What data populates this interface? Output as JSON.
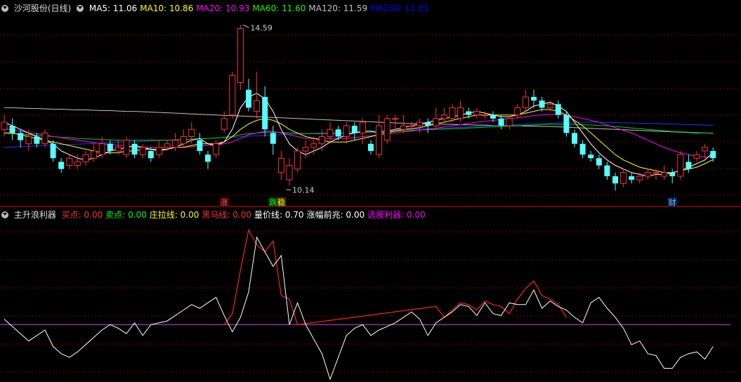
{
  "main_legend": {
    "title": "沙河股份(日线)",
    "items": [
      {
        "label": "MA5: 11.06",
        "color": "#ffffff"
      },
      {
        "label": "MA10: 10.86",
        "color": "#ffff00"
      },
      {
        "label": "MA20: 10.93",
        "color": "#ff00ff"
      },
      {
        "label": "MA60: 11.60",
        "color": "#00ff00"
      },
      {
        "label": "MA120: 11.59",
        "color": "#c0c0c0"
      },
      {
        "label": "MA250: 11.81",
        "color": "#0000ff"
      }
    ]
  },
  "sub_legend": {
    "title": "主升浪利器",
    "items": [
      {
        "label": "买点: 0.00",
        "color": "#ff3030"
      },
      {
        "label": "卖点: 0.00",
        "color": "#00ff00"
      },
      {
        "label": "庄拉线: 0.00",
        "color": "#ffff00"
      },
      {
        "label": "黑马线: 0.00",
        "color": "#ff3030"
      },
      {
        "label": "量价线: 0.70",
        "color": "#ffffff"
      },
      {
        "label": "涨幅前兆: 0.00",
        "color": "#ffffff"
      },
      {
        "label": "选股利器: 0.00",
        "color": "#ff00ff"
      }
    ]
  },
  "annotations": {
    "high_label": "14.59",
    "low_label": "10.14",
    "markers": [
      {
        "text": "涨",
        "color": "#ff5050",
        "bg": "#400000",
        "day": 27
      },
      {
        "text": "跌",
        "color": "#00ff00",
        "bg": "#003000",
        "day": 33
      },
      {
        "text": "稳",
        "color": "#ffff00",
        "bg": "#403000",
        "day": 34
      },
      {
        "text": "财",
        "color": "#80c0ff",
        "bg": "#002050",
        "day": 82
      }
    ]
  },
  "chart_data": {
    "type": "candlestick",
    "price_ylim": [
      9.6,
      14.9
    ],
    "candles": [
      [
        11.7,
        11.9,
        12.1,
        11.5
      ],
      [
        11.8,
        11.6,
        12.0,
        11.4
      ],
      [
        11.6,
        11.4,
        11.7,
        11.2
      ],
      [
        11.3,
        11.5,
        11.7,
        11.1
      ],
      [
        11.5,
        11.3,
        11.6,
        11.2
      ],
      [
        11.3,
        11.6,
        11.7,
        11.2
      ],
      [
        11.3,
        10.9,
        11.4,
        10.8
      ],
      [
        10.8,
        10.6,
        10.9,
        10.5
      ],
      [
        10.7,
        10.9,
        11.0,
        10.6
      ],
      [
        10.7,
        10.8,
        11.0,
        10.6
      ],
      [
        10.8,
        11.0,
        11.1,
        10.7
      ],
      [
        10.9,
        11.1,
        11.3,
        10.8
      ],
      [
        11.0,
        11.3,
        11.5,
        10.9
      ],
      [
        11.3,
        11.1,
        11.4,
        11.0
      ],
      [
        11.1,
        11.2,
        11.4,
        11.0
      ],
      [
        11.0,
        11.4,
        11.5,
        10.9
      ],
      [
        11.3,
        11.0,
        11.4,
        10.9
      ],
      [
        11.0,
        11.2,
        11.3,
        10.9
      ],
      [
        11.1,
        10.9,
        11.2,
        10.8
      ],
      [
        11.0,
        11.2,
        11.4,
        10.9
      ],
      [
        11.2,
        11.3,
        11.4,
        11.1
      ],
      [
        11.2,
        11.4,
        11.6,
        11.1
      ],
      [
        11.3,
        11.5,
        11.7,
        11.2
      ],
      [
        11.5,
        11.7,
        11.9,
        11.3
      ],
      [
        11.4,
        11.1,
        11.6,
        11.0
      ],
      [
        11.0,
        10.8,
        11.1,
        10.6
      ],
      [
        11.0,
        11.3,
        11.4,
        10.9
      ],
      [
        11.7,
        12.0,
        12.2,
        11.6
      ],
      [
        12.1,
        13.2,
        13.3,
        12.0
      ],
      [
        13.0,
        14.5,
        14.6,
        12.8
      ],
      [
        12.8,
        12.3,
        13.1,
        12.2
      ],
      [
        12.2,
        12.5,
        13.3,
        12.0
      ],
      [
        12.6,
        11.7,
        12.9,
        11.5
      ],
      [
        11.6,
        11.3,
        11.8,
        11.0
      ],
      [
        10.5,
        10.9,
        11.1,
        10.3
      ],
      [
        10.3,
        10.7,
        10.9,
        10.14
      ],
      [
        10.6,
        11.1,
        11.2,
        10.5
      ],
      [
        11.1,
        11.2,
        11.4,
        10.9
      ],
      [
        11.2,
        11.3,
        11.5,
        11.0
      ],
      [
        11.3,
        11.5,
        11.7,
        11.1
      ],
      [
        11.5,
        11.7,
        11.9,
        11.3
      ],
      [
        11.7,
        11.5,
        11.8,
        11.4
      ],
      [
        11.5,
        11.8,
        11.9,
        11.3
      ],
      [
        11.8,
        11.6,
        11.9,
        11.4
      ],
      [
        11.6,
        11.9,
        12.0,
        11.3
      ],
      [
        11.3,
        11.1,
        11.4,
        11.0
      ],
      [
        11.0,
        11.8,
        12.1,
        10.9
      ],
      [
        11.4,
        12.0,
        12.1,
        11.3
      ],
      [
        12.0,
        12.0,
        12.1,
        11.6
      ],
      [
        11.7,
        11.8,
        12.1,
        11.6
      ],
      [
        11.8,
        11.8,
        11.9,
        11.7
      ],
      [
        11.8,
        11.9,
        12.0,
        11.6
      ],
      [
        11.9,
        11.8,
        12.0,
        11.6
      ],
      [
        11.8,
        12.0,
        12.3,
        11.7
      ],
      [
        12.0,
        12.1,
        12.3,
        11.9
      ],
      [
        12.0,
        12.3,
        12.4,
        11.9
      ],
      [
        12.0,
        12.3,
        12.5,
        11.9
      ],
      [
        12.2,
        12.1,
        12.3,
        12.0
      ],
      [
        12.1,
        12.2,
        12.3,
        12.0
      ],
      [
        12.1,
        12.1,
        12.2,
        12.0
      ],
      [
        12.1,
        12.0,
        12.2,
        11.9
      ],
      [
        12.0,
        11.8,
        12.1,
        11.7
      ],
      [
        11.8,
        12.0,
        12.1,
        11.7
      ],
      [
        12.1,
        12.3,
        12.4,
        12.0
      ],
      [
        12.3,
        12.6,
        12.8,
        12.2
      ],
      [
        12.6,
        12.5,
        12.8,
        12.3
      ],
      [
        12.5,
        12.3,
        12.6,
        12.2
      ],
      [
        12.3,
        12.4,
        12.5,
        12.2
      ],
      [
        12.4,
        12.1,
        12.5,
        12.0
      ],
      [
        12.1,
        11.6,
        12.2,
        11.5
      ],
      [
        11.6,
        11.3,
        11.7,
        11.2
      ],
      [
        11.3,
        11.0,
        11.4,
        10.9
      ],
      [
        11.0,
        10.9,
        11.1,
        10.8
      ],
      [
        10.9,
        10.7,
        11.0,
        10.6
      ],
      [
        10.7,
        10.4,
        10.8,
        10.3
      ],
      [
        10.4,
        10.2,
        10.5,
        10.0
      ],
      [
        10.2,
        10.5,
        10.6,
        10.1
      ],
      [
        10.4,
        10.3,
        10.5,
        10.2
      ],
      [
        10.3,
        10.4,
        10.5,
        10.2
      ],
      [
        10.4,
        10.5,
        10.6,
        10.3
      ],
      [
        10.5,
        10.5,
        10.6,
        10.3
      ],
      [
        10.4,
        10.5,
        10.7,
        10.3
      ],
      [
        10.5,
        10.4,
        10.6,
        10.2
      ],
      [
        10.4,
        11.0,
        11.1,
        10.3
      ],
      [
        10.8,
        10.6,
        11.0,
        10.5
      ],
      [
        10.9,
        11.0,
        11.1,
        10.8
      ],
      [
        11.1,
        11.2,
        11.3,
        10.9
      ],
      [
        11.1,
        10.9,
        11.2,
        10.8
      ]
    ],
    "ma5": [
      11.9,
      11.8,
      11.7,
      11.6,
      11.5,
      11.4,
      11.3,
      11.1,
      11.0,
      10.9,
      10.85,
      10.9,
      11.0,
      11.1,
      11.15,
      11.2,
      11.25,
      11.2,
      11.15,
      11.1,
      11.15,
      11.2,
      11.3,
      11.4,
      11.45,
      11.3,
      11.25,
      11.35,
      11.7,
      12.3,
      12.6,
      12.7,
      12.55,
      12.2,
      11.7,
      11.3,
      11.1,
      11.0,
      11.1,
      11.2,
      11.35,
      11.45,
      11.55,
      11.6,
      11.65,
      11.65,
      11.6,
      11.65,
      11.7,
      11.75,
      11.8,
      11.85,
      11.9,
      11.95,
      12.0,
      12.05,
      12.1,
      12.15,
      12.2,
      12.15,
      12.1,
      12.05,
      12.05,
      12.1,
      12.2,
      12.35,
      12.4,
      12.45,
      12.35,
      12.2,
      11.9,
      11.6,
      11.3,
      11.05,
      10.85,
      10.7,
      10.6,
      10.5,
      10.45,
      10.4,
      10.45,
      10.45,
      10.5,
      10.55,
      10.65,
      10.75,
      10.85,
      11.06
    ],
    "ma10": [
      11.6,
      11.6,
      11.55,
      11.5,
      11.45,
      11.4,
      11.35,
      11.3,
      11.25,
      11.2,
      11.15,
      11.1,
      11.05,
      11.05,
      11.05,
      11.1,
      11.1,
      11.15,
      11.15,
      11.15,
      11.15,
      11.2,
      11.2,
      11.25,
      11.3,
      11.3,
      11.3,
      11.35,
      11.5,
      11.7,
      11.85,
      11.95,
      12.0,
      11.95,
      11.85,
      11.7,
      11.6,
      11.5,
      11.45,
      11.4,
      11.35,
      11.35,
      11.35,
      11.4,
      11.45,
      11.5,
      11.55,
      11.6,
      11.65,
      11.7,
      11.72,
      11.75,
      11.8,
      11.85,
      11.9,
      11.95,
      12.0,
      12.05,
      12.1,
      12.1,
      12.1,
      12.1,
      12.1,
      12.1,
      12.15,
      12.2,
      12.25,
      12.25,
      12.2,
      12.1,
      11.95,
      11.8,
      11.6,
      11.4,
      11.2,
      11.0,
      10.85,
      10.75,
      10.65,
      10.6,
      10.55,
      10.5,
      10.5,
      10.55,
      10.6,
      10.65,
      10.75,
      10.86
    ],
    "ma20": [
      11.7,
      11.7,
      11.65,
      11.6,
      11.58,
      11.55,
      11.5,
      11.47,
      11.43,
      11.4,
      11.37,
      11.33,
      11.3,
      11.28,
      11.25,
      11.23,
      11.2,
      11.2,
      11.2,
      11.2,
      11.2,
      11.2,
      11.2,
      11.22,
      11.25,
      11.25,
      11.27,
      11.3,
      11.35,
      11.45,
      11.55,
      11.6,
      11.65,
      11.65,
      11.6,
      11.55,
      11.5,
      11.45,
      11.45,
      11.45,
      11.45,
      11.45,
      11.45,
      11.47,
      11.5,
      11.52,
      11.55,
      11.58,
      11.6,
      11.63,
      11.65,
      11.68,
      11.7,
      11.73,
      11.77,
      11.8,
      11.83,
      11.87,
      11.9,
      11.92,
      11.95,
      11.97,
      12.0,
      12.02,
      12.05,
      12.08,
      12.1,
      12.12,
      12.12,
      12.1,
      12.05,
      12.0,
      11.95,
      11.9,
      11.82,
      11.75,
      11.67,
      11.6,
      11.5,
      11.4,
      11.3,
      11.2,
      11.12,
      11.05,
      11.0,
      10.95,
      10.93,
      10.93
    ],
    "ma60": [
      11.6,
      11.58,
      11.57,
      11.55,
      11.53,
      11.52,
      11.5,
      11.48,
      11.47,
      11.45,
      11.44,
      11.43,
      11.42,
      11.41,
      11.4,
      11.4,
      11.4,
      11.4,
      11.4,
      11.4,
      11.4,
      11.41,
      11.42,
      11.43,
      11.44,
      11.45,
      11.46,
      11.48,
      11.5,
      11.55,
      11.58,
      11.6,
      11.62,
      11.62,
      11.61,
      11.6,
      11.59,
      11.58,
      11.58,
      11.58,
      11.58,
      11.58,
      11.59,
      11.6,
      11.61,
      11.62,
      11.63,
      11.64,
      11.65,
      11.66,
      11.67,
      11.68,
      11.69,
      11.7,
      11.71,
      11.72,
      11.73,
      11.74,
      11.75,
      11.76,
      11.77,
      11.78,
      11.79,
      11.8,
      11.81,
      11.82,
      11.83,
      11.84,
      11.84,
      11.84,
      11.84,
      11.83,
      11.82,
      11.81,
      11.8,
      11.78,
      11.76,
      11.74,
      11.72,
      11.7,
      11.68,
      11.66,
      11.64,
      11.63,
      11.62,
      11.61,
      11.6,
      11.6
    ],
    "ma120": [
      12.3,
      12.3,
      12.29,
      12.28,
      12.28,
      12.27,
      12.26,
      12.26,
      12.25,
      12.24,
      12.24,
      12.23,
      12.22,
      12.22,
      12.21,
      12.2,
      12.2,
      12.19,
      12.18,
      12.17,
      12.16,
      12.15,
      12.14,
      12.13,
      12.12,
      12.11,
      12.1,
      12.09,
      12.08,
      12.07,
      12.06,
      12.05,
      12.04,
      12.03,
      12.02,
      12.01,
      12.0,
      11.99,
      11.98,
      11.97,
      11.96,
      11.95,
      11.94,
      11.93,
      11.92,
      11.91,
      11.9,
      11.89,
      11.88,
      11.87,
      11.86,
      11.86,
      11.85,
      11.85,
      11.84,
      11.84,
      11.83,
      11.83,
      11.82,
      11.82,
      11.81,
      11.81,
      11.8,
      11.8,
      11.79,
      11.79,
      11.78,
      11.78,
      11.77,
      11.76,
      11.75,
      11.74,
      11.73,
      11.72,
      11.71,
      11.7,
      11.69,
      11.68,
      11.67,
      11.66,
      11.65,
      11.64,
      11.63,
      11.62,
      11.61,
      11.6,
      11.6,
      11.59
    ],
    "ma250": [
      11.2,
      11.21,
      11.22,
      11.23,
      11.24,
      11.25,
      11.26,
      11.27,
      11.28,
      11.29,
      11.3,
      11.31,
      11.32,
      11.33,
      11.34,
      11.35,
      11.36,
      11.37,
      11.38,
      11.39,
      11.4,
      11.41,
      11.42,
      11.43,
      11.44,
      11.45,
      11.46,
      11.47,
      11.48,
      11.5,
      11.51,
      11.52,
      11.53,
      11.54,
      11.55,
      11.56,
      11.57,
      11.58,
      11.59,
      11.6,
      11.61,
      11.62,
      11.62,
      11.63,
      11.64,
      11.65,
      11.66,
      11.67,
      11.68,
      11.69,
      11.7,
      11.71,
      11.72,
      11.73,
      11.74,
      11.75,
      11.76,
      11.77,
      11.78,
      11.79,
      11.8,
      11.81,
      11.82,
      11.83,
      11.84,
      11.85,
      11.86,
      11.87,
      11.88,
      11.89,
      11.9,
      11.9,
      11.9,
      11.9,
      11.89,
      11.89,
      11.88,
      11.88,
      11.87,
      11.87,
      11.86,
      11.85,
      11.85,
      11.84,
      11.83,
      11.83,
      11.82,
      11.81
    ],
    "sub_ylim": [
      -1.5,
      2.9
    ],
    "sub_baseline": 0,
    "sub_white": [
      0.15,
      -0.05,
      -0.25,
      -0.45,
      -0.3,
      -0.15,
      -0.6,
      -0.8,
      -0.9,
      -0.75,
      -0.55,
      -0.35,
      -0.15,
      0.0,
      -0.1,
      -0.25,
      0.05,
      -0.3,
      0.0,
      0.05,
      0.1,
      0.25,
      0.4,
      0.55,
      0.45,
      0.6,
      0.75,
      0.25,
      -0.2,
      0.2,
      0.9,
      2.4,
      2.0,
      1.6,
      1.9,
      0.0,
      0.6,
      0.0,
      -0.4,
      -0.8,
      -1.5,
      -0.9,
      -0.3,
      -0.1,
      0.0,
      -0.3,
      -0.15,
      -0.05,
      0.05,
      0.2,
      0.35,
      0.15,
      -0.3,
      0.05,
      0.2,
      0.35,
      0.55,
      0.5,
      0.25,
      0.6,
      0.3,
      0.25,
      0.6,
      0.55,
      0.55,
      0.95,
      0.45,
      0.65,
      0.5,
      0.4,
      0.2,
      0.05,
      0.6,
      0.75,
      0.45,
      0.2,
      -0.1,
      -0.55,
      -0.45,
      -0.8,
      -0.85,
      -1.2,
      -1.2,
      -0.9,
      -0.8,
      -0.75,
      -0.95,
      -0.6
    ],
    "sub_red": [
      null,
      null,
      null,
      null,
      null,
      null,
      null,
      null,
      null,
      null,
      null,
      null,
      null,
      null,
      null,
      null,
      null,
      null,
      null,
      null,
      null,
      null,
      null,
      null,
      null,
      null,
      null,
      0.0,
      0.3,
      1.5,
      2.6,
      2.2,
      2.0,
      2.3,
      0.8,
      0.7,
      0.0,
      null,
      null,
      null,
      null,
      null,
      null,
      null,
      null,
      null,
      null,
      null,
      null,
      null,
      null,
      null,
      null,
      0.5,
      0.2,
      0.4,
      0.6,
      0.55,
      0.4,
      0.65,
      0.55,
      0.5,
      0.3,
      0.7,
      1.0,
      1.2,
      0.8,
      0.7,
      0.55,
      0.2,
      null,
      null,
      null,
      null,
      null,
      null,
      null,
      null,
      null,
      null,
      null,
      null,
      null,
      null,
      null,
      null,
      null,
      null
    ]
  }
}
